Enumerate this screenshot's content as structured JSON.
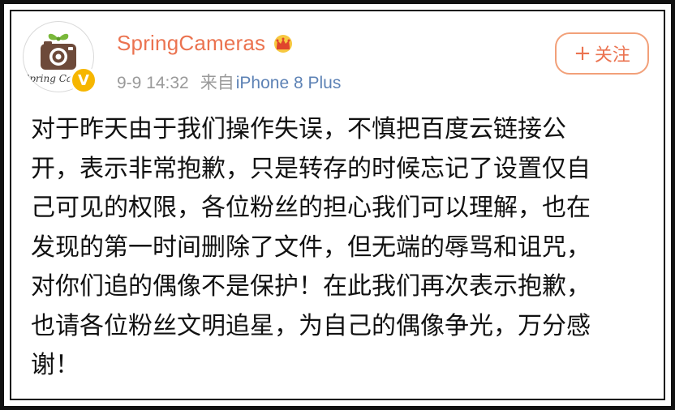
{
  "post": {
    "author": {
      "name": "SpringCameras",
      "avatar_text": "Spring Cam",
      "verified_icon": "verified-v-icon",
      "badge_icon": "crown-icon"
    },
    "time": "9-9 14:32",
    "source_prefix": "来自",
    "source_device": "iPhone 8 Plus",
    "follow_button": {
      "plus": "+",
      "label": "关注"
    },
    "content_lines": [
      "对于昨天由于我们操作失误，不慎把百度云链接公",
      "开，表示非常抱歉，只是转存的时候忘记了设置仅自",
      "己可见的权限，各位粉丝的担心我们可以理解，也在",
      "发现的第一时间删除了文件，但无端的辱骂和诅咒，",
      "对你们追的偶像不是保护！在此我们再次表示抱歉，",
      "也请各位粉丝文明追星，为自己的偶像争光，万分感",
      "谢！"
    ]
  },
  "colors": {
    "accent": "#eb7350",
    "link": "#5d82b5",
    "meta": "#9a9a9a",
    "verified": "#f6b600"
  }
}
